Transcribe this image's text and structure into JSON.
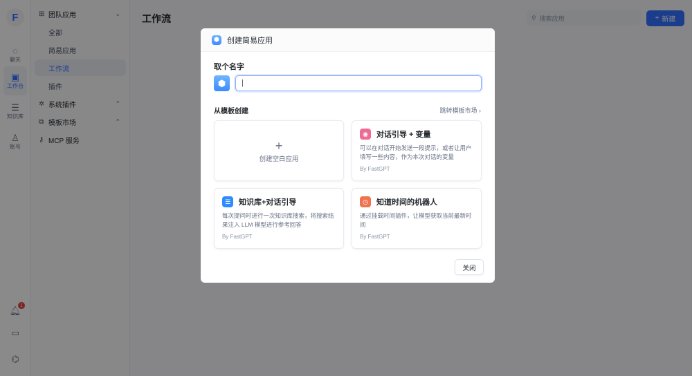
{
  "rail": {
    "items": [
      {
        "label": "聊天",
        "icon": "chat-icon"
      },
      {
        "label": "工作台",
        "icon": "robot-icon"
      },
      {
        "label": "知识库",
        "icon": "database-icon"
      },
      {
        "label": "账号",
        "icon": "user-icon"
      }
    ],
    "notification_count": "1"
  },
  "nav": {
    "team_apps": "团队应用",
    "all": "全部",
    "simple": "简易应用",
    "workflow": "工作流",
    "plugin": "插件",
    "system_plugins": "系统插件",
    "template_market": "模板市场",
    "mcp": "MCP 服务"
  },
  "header": {
    "title": "工作流",
    "search_placeholder": "搜索应用",
    "new_label": "新建"
  },
  "modal": {
    "title": "创建简易应用",
    "name_label": "取个名字",
    "name_value": "|",
    "from_template": "从模板创建",
    "jump_market": "跳转模板市场",
    "blank_label": "创建空白应用",
    "templates": [
      {
        "title": "对话引导 + 变量",
        "desc": "可以在对话开始发送一段提示，或者让用户填写一些内容，作为本次对话的变量",
        "by": "By FastGPT",
        "color": "#f06b93"
      },
      {
        "title": "知识库+对话引导",
        "desc": "每次提问时进行一次知识库搜索，将搜索结果注入 LLM 模型进行参考回答",
        "by": "By FastGPT",
        "color": "#2f8cff"
      },
      {
        "title": "知道时间的机器人",
        "desc": "通过挂载时间插件，让模型获取当前最新时间",
        "by": "By FastGPT",
        "color": "#f0734f"
      }
    ],
    "close_label": "关闭"
  }
}
